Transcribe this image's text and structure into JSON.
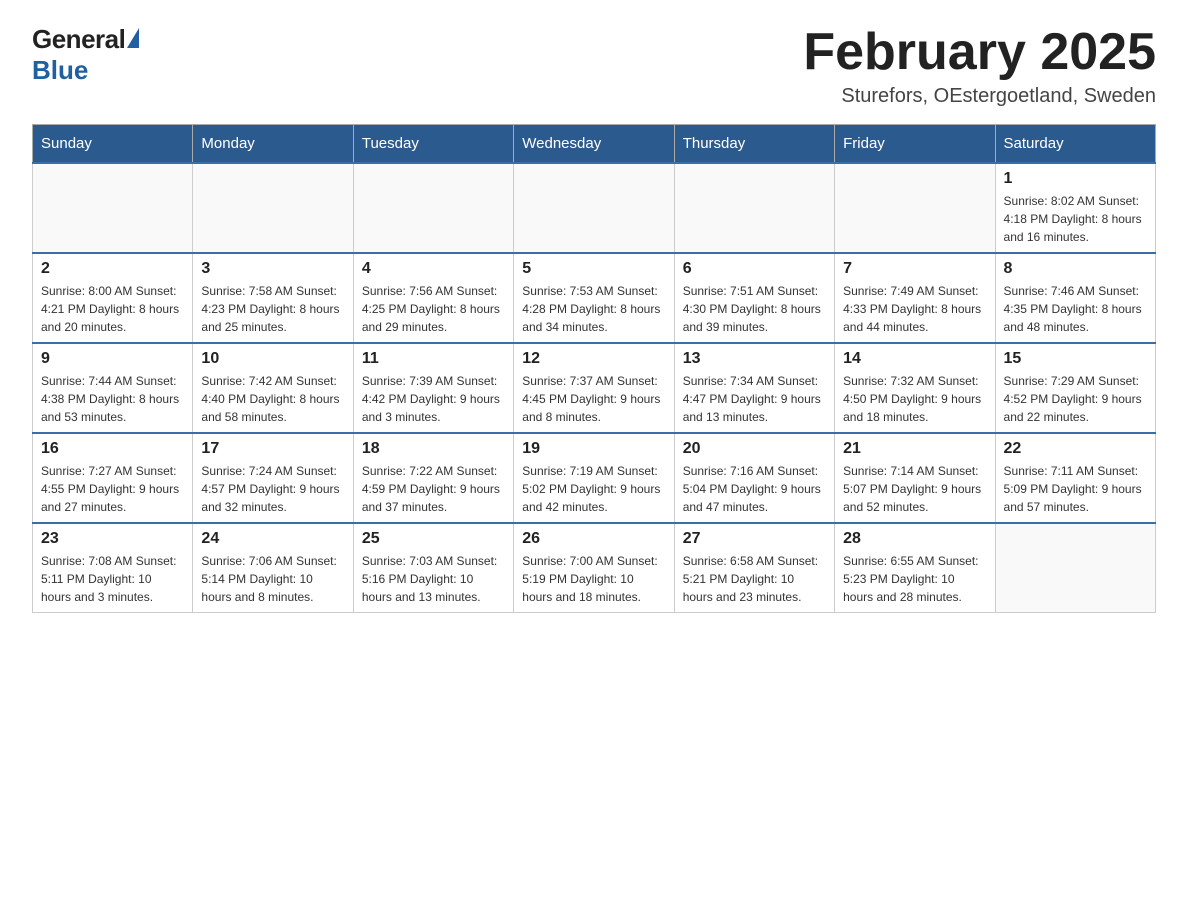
{
  "header": {
    "logo_text_main": "General",
    "logo_text_blue": "Blue",
    "title": "February 2025",
    "subtitle": "Sturefors, OEstergoetland, Sweden"
  },
  "days_of_week": [
    "Sunday",
    "Monday",
    "Tuesday",
    "Wednesday",
    "Thursday",
    "Friday",
    "Saturday"
  ],
  "weeks": [
    [
      {
        "day": "",
        "info": ""
      },
      {
        "day": "",
        "info": ""
      },
      {
        "day": "",
        "info": ""
      },
      {
        "day": "",
        "info": ""
      },
      {
        "day": "",
        "info": ""
      },
      {
        "day": "",
        "info": ""
      },
      {
        "day": "1",
        "info": "Sunrise: 8:02 AM\nSunset: 4:18 PM\nDaylight: 8 hours and 16 minutes."
      }
    ],
    [
      {
        "day": "2",
        "info": "Sunrise: 8:00 AM\nSunset: 4:21 PM\nDaylight: 8 hours and 20 minutes."
      },
      {
        "day": "3",
        "info": "Sunrise: 7:58 AM\nSunset: 4:23 PM\nDaylight: 8 hours and 25 minutes."
      },
      {
        "day": "4",
        "info": "Sunrise: 7:56 AM\nSunset: 4:25 PM\nDaylight: 8 hours and 29 minutes."
      },
      {
        "day": "5",
        "info": "Sunrise: 7:53 AM\nSunset: 4:28 PM\nDaylight: 8 hours and 34 minutes."
      },
      {
        "day": "6",
        "info": "Sunrise: 7:51 AM\nSunset: 4:30 PM\nDaylight: 8 hours and 39 minutes."
      },
      {
        "day": "7",
        "info": "Sunrise: 7:49 AM\nSunset: 4:33 PM\nDaylight: 8 hours and 44 minutes."
      },
      {
        "day": "8",
        "info": "Sunrise: 7:46 AM\nSunset: 4:35 PM\nDaylight: 8 hours and 48 minutes."
      }
    ],
    [
      {
        "day": "9",
        "info": "Sunrise: 7:44 AM\nSunset: 4:38 PM\nDaylight: 8 hours and 53 minutes."
      },
      {
        "day": "10",
        "info": "Sunrise: 7:42 AM\nSunset: 4:40 PM\nDaylight: 8 hours and 58 minutes."
      },
      {
        "day": "11",
        "info": "Sunrise: 7:39 AM\nSunset: 4:42 PM\nDaylight: 9 hours and 3 minutes."
      },
      {
        "day": "12",
        "info": "Sunrise: 7:37 AM\nSunset: 4:45 PM\nDaylight: 9 hours and 8 minutes."
      },
      {
        "day": "13",
        "info": "Sunrise: 7:34 AM\nSunset: 4:47 PM\nDaylight: 9 hours and 13 minutes."
      },
      {
        "day": "14",
        "info": "Sunrise: 7:32 AM\nSunset: 4:50 PM\nDaylight: 9 hours and 18 minutes."
      },
      {
        "day": "15",
        "info": "Sunrise: 7:29 AM\nSunset: 4:52 PM\nDaylight: 9 hours and 22 minutes."
      }
    ],
    [
      {
        "day": "16",
        "info": "Sunrise: 7:27 AM\nSunset: 4:55 PM\nDaylight: 9 hours and 27 minutes."
      },
      {
        "day": "17",
        "info": "Sunrise: 7:24 AM\nSunset: 4:57 PM\nDaylight: 9 hours and 32 minutes."
      },
      {
        "day": "18",
        "info": "Sunrise: 7:22 AM\nSunset: 4:59 PM\nDaylight: 9 hours and 37 minutes."
      },
      {
        "day": "19",
        "info": "Sunrise: 7:19 AM\nSunset: 5:02 PM\nDaylight: 9 hours and 42 minutes."
      },
      {
        "day": "20",
        "info": "Sunrise: 7:16 AM\nSunset: 5:04 PM\nDaylight: 9 hours and 47 minutes."
      },
      {
        "day": "21",
        "info": "Sunrise: 7:14 AM\nSunset: 5:07 PM\nDaylight: 9 hours and 52 minutes."
      },
      {
        "day": "22",
        "info": "Sunrise: 7:11 AM\nSunset: 5:09 PM\nDaylight: 9 hours and 57 minutes."
      }
    ],
    [
      {
        "day": "23",
        "info": "Sunrise: 7:08 AM\nSunset: 5:11 PM\nDaylight: 10 hours and 3 minutes."
      },
      {
        "day": "24",
        "info": "Sunrise: 7:06 AM\nSunset: 5:14 PM\nDaylight: 10 hours and 8 minutes."
      },
      {
        "day": "25",
        "info": "Sunrise: 7:03 AM\nSunset: 5:16 PM\nDaylight: 10 hours and 13 minutes."
      },
      {
        "day": "26",
        "info": "Sunrise: 7:00 AM\nSunset: 5:19 PM\nDaylight: 10 hours and 18 minutes."
      },
      {
        "day": "27",
        "info": "Sunrise: 6:58 AM\nSunset: 5:21 PM\nDaylight: 10 hours and 23 minutes."
      },
      {
        "day": "28",
        "info": "Sunrise: 6:55 AM\nSunset: 5:23 PM\nDaylight: 10 hours and 28 minutes."
      },
      {
        "day": "",
        "info": ""
      }
    ]
  ]
}
